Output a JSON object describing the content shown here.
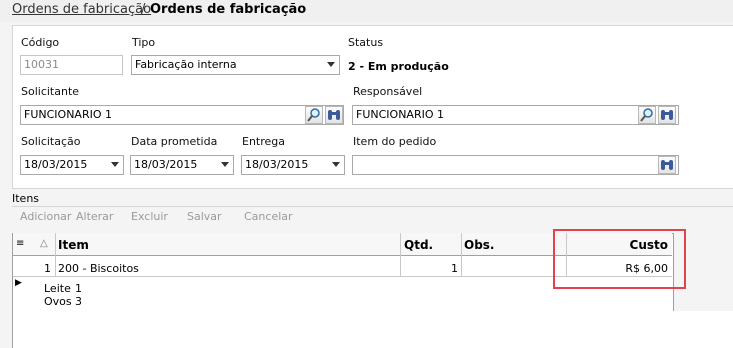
{
  "breadcrumb": {
    "link": "Ordens de fabricação",
    "separator": "/",
    "current": "Ordens de fabricação"
  },
  "form": {
    "codigo": {
      "label": "Código",
      "value": "10031"
    },
    "tipo": {
      "label": "Tipo",
      "value": "Fabricação interna"
    },
    "status": {
      "label": "Status",
      "value": "2 - Em produção"
    },
    "solicitante": {
      "label": "Solicitante",
      "value": "FUNCIONARIO 1"
    },
    "responsavel": {
      "label": "Responsável",
      "value": "FUNCIONARIO 1"
    },
    "solicitacao": {
      "label": "Solicitação",
      "value": "18/03/2015"
    },
    "data_prometida": {
      "label": "Data prometida",
      "value": "18/03/2015"
    },
    "entrega": {
      "label": "Entrega",
      "value": "18/03/2015"
    },
    "item_pedido": {
      "label": "Item do pedido",
      "value": ""
    }
  },
  "itens": {
    "label": "Itens",
    "toolbar": {
      "add": "Adicionar",
      "edit": "Alterar",
      "delete": "Excluir",
      "save": "Salvar",
      "cancel": "Cancelar"
    },
    "columns": {
      "item": "Item",
      "qtd": "Qtd.",
      "obs": "Obs.",
      "custo": "Custo"
    },
    "rows": [
      {
        "index": "1",
        "item": "200 - Biscoitos",
        "qtd": "1",
        "obs": "",
        "custo": "R$ 6,00"
      }
    ],
    "detail": [
      {
        "name": "Leite",
        "qty": "1"
      },
      {
        "name": "Ovos",
        "qty": "3"
      }
    ]
  },
  "icons": {
    "search": "magnifier-icon",
    "binoculars": "binoculars-icon",
    "dropdown": "chevron-down-icon",
    "row_marker": "row-pointer-icon",
    "sort": "sort-triangle-icon"
  },
  "colors": {
    "highlight": "#e0434b",
    "link": "#333333"
  }
}
